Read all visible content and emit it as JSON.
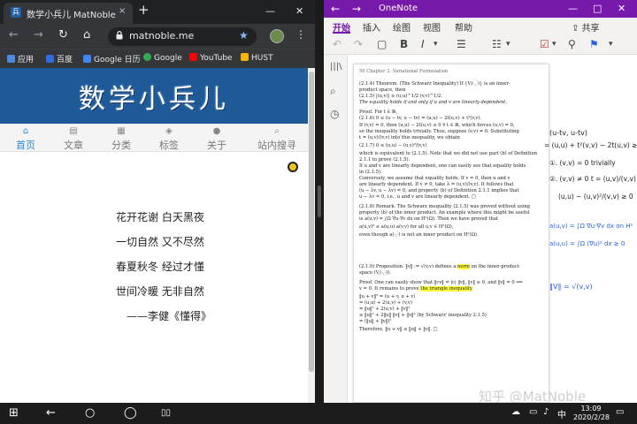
{
  "chrome": {
    "tab_title": "数学小兵儿 MatNoble",
    "tab_close": "×",
    "new_tab": "+",
    "win_min": "—",
    "win_close": "✕",
    "nav": {
      "back": "←",
      "forward": "→",
      "reload": "↻",
      "home": "⌂"
    },
    "url": "matnoble.me",
    "star": "★",
    "menu": "⋮",
    "bookmarks": [
      "应用",
      "百度",
      "Google 日历",
      "Google",
      "YouTube",
      "HUST"
    ],
    "bookmark_colors": [
      "#4a89dc",
      "#2f6de1",
      "#4285f4",
      "#34a853",
      "#ff0000",
      "#f4b400"
    ]
  },
  "site": {
    "title": "数学小兵儿",
    "nav": [
      {
        "label": "首页",
        "icon": "⌂"
      },
      {
        "label": "文章",
        "icon": "▤"
      },
      {
        "label": "分类",
        "icon": "▦"
      },
      {
        "label": "标签",
        "icon": "◈"
      },
      {
        "label": "关于",
        "icon": "●"
      },
      {
        "label": "站内搜寻",
        "icon": "⌕"
      }
    ],
    "active_nav": "首页",
    "poem": [
      "花开花谢 白天黑夜",
      "一切自然 又不尽然",
      "春夏秋冬 经过才懂",
      "世间冷暖 无非自然",
      "——李健《懂得》"
    ]
  },
  "onenote": {
    "app_name": "OneNote",
    "back": "←",
    "forward": "→",
    "minimize": "—",
    "maximize": "□",
    "close": "✕",
    "tabs": [
      "开始",
      "插入",
      "绘图",
      "视图",
      "帮助"
    ],
    "active_tab": "开始",
    "share": "共享",
    "ribbon": [
      "↶",
      "↷",
      "▢",
      "B",
      "I",
      "▾",
      "☰",
      "☷",
      "▾",
      "☑",
      "▾",
      "⚲",
      "⚑",
      "▾"
    ],
    "sidebar": [
      "|||\\",
      "⌕",
      "◷"
    ],
    "pdf": {
      "header": "50    Chapter 2. Variational Formulation",
      "l1": "(2.1.4) Theorem. (The Schwarz Inequality)  If {V,(·,·)} is an inner-",
      "l2": "product space, then",
      "l3": "(2.1.5)                 |(u,v)| ≤ (u,u)^1/2 (v,v)^1/2.",
      "l4": "The equality holds if and only if u and v are linearly dependent.",
      "l5": "Proof. For t ∈ ℝ,",
      "l6": "(2.1.6)        0 ≤ (u − tv, u − tv) = (u,u) − 2t(u,v) + t²(v,v).",
      "l7": "If (v,v) = 0, then (u,u) − 2t(u,v) ≥ 0  ∀ t ∈ ℝ, which forces (u,v) = 0,",
      "l8": "so the inequality holds trivially. Thus, suppose (v,v) ≠ 0. Substituting",
      "l9": "t = (u,v)/(v,v) into this inequality, we obtain",
      "l10": "(2.1.7)                 0 ≤ (u,u) − (u,v)²/(v,v)",
      "l11": "which is equivalent to (2.1.5). Note that we did not use part (b) of Definition",
      "l12": "2.1.1 to prove (2.1.5).",
      "l13": "   If u and v are linearly dependent, one can easily see that equality holds",
      "l14": "in (2.1.5).",
      "l15": "   Conversely, we assume that equality holds. If v = 0, then u and v",
      "l16": "are linearly dependent. If v ≠ 0, take λ = (u,v)/(v,v). It follows that",
      "l17": "(u − λv, u − λv) = 0, and property (b) of Definition 2.1.1 implies that",
      "l18": "u − λv = 0, i.e., u and v are linearly dependent.                            □",
      "l19": "(2.1.8) Remark. The Schwarz inequality (2.1.5) was proved without using",
      "l20": "property (b) of the inner product. An example where this might be useful",
      "l21": "is a(u,v) = ∫Ω ∇u·∇v dx on H¹(Ω). Then we have proved that",
      "l22": "            a(u,v)² ≤ a(u,u) a(v,v)        for all u,v ∈ H¹(Ω),",
      "l23": "even though a(·,·) is not an inner product on H¹(Ω).",
      "l24a": "(2.1.9) Proposition. ‖v‖ := √(v,v) defines a ",
      "l24b": "norm",
      "l24c": " on the inner-product",
      "l25": "space (V,(·,·)).",
      "l26": "Proof. One can easily show that ‖cv‖ = |c| ‖v‖, ‖v‖ ≥ 0, and ‖v‖ = 0 ⟹",
      "l27a": "v = 0. It remains to prove ",
      "l27b": "the triangle inequality",
      "l27c": ".",
      "l28": "   ‖u + v‖² = (u + v, u + v)",
      "l29": "            = (u,u) + 2(u,v) + (v,v)",
      "l30": "            = ‖u‖² + 2(u,v) + ‖v‖²",
      "l31": "            ≤ ‖u‖² + 2‖u‖ ‖v‖ + ‖v‖²      (by Schwarz' inequality 2.1.5)",
      "l32": "            = (‖u‖ + ‖v‖)²",
      "l33": "Therefore, ‖u + v‖ ≤ ‖u‖ + ‖v‖.                                                   □"
    },
    "ink": {
      "i1": "(u-tv, u-tv)",
      "i2": "= (u,u) + t²(v,v) − 2t(u,v) ≥ 0",
      "i3": "①. (v,v) = 0      trivially",
      "i4": "②. (v,v) ≠ 0      t = (u,v)/(v,v)",
      "i5": "(u,u) − (u,v)²/(v,v) ≥ 0",
      "i6": "a(u,v) = ∫Ω ∇u·∇v dx  on H¹",
      "i7": "a(u,u) = ∫Ω (∇u)² dx ≥ 0",
      "i8": "‖V‖ = √(v,v)"
    },
    "watermark": "知乎 @MatNoble"
  },
  "taskbar": {
    "start": "⊞",
    "back": "←",
    "search": "○",
    "cortana": "◯",
    "taskview": "▯▯",
    "tray_icons": [
      "☁",
      "▭",
      "♪",
      "中"
    ],
    "time": "13:09",
    "date": "2020/2/28"
  }
}
